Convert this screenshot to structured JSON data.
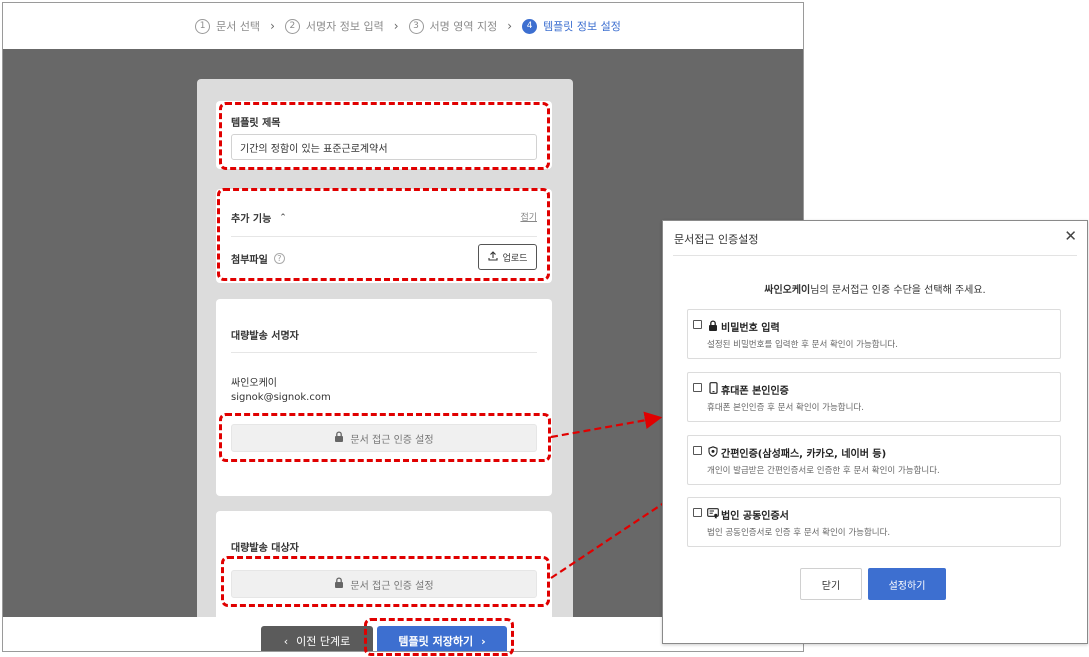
{
  "colors": {
    "accent": "#3d6fd0",
    "highlight": "#e00000",
    "dim_overlay": "#686868"
  },
  "stepper": {
    "steps": [
      {
        "num": "1",
        "label": "문서 선택"
      },
      {
        "num": "2",
        "label": "서명자 정보 입력"
      },
      {
        "num": "3",
        "label": "서명 영역 지정"
      },
      {
        "num": "4",
        "label": "템플릿 정보 설정"
      }
    ],
    "active_index": 3
  },
  "template_title": {
    "label": "템플릿 제목",
    "value": "기간의 정함이 있는 표준근로계약서"
  },
  "extra_features": {
    "label": "추가 기능",
    "collapse_link": "접기",
    "attachment_label": "첨부파일",
    "upload_label": "업로드"
  },
  "bulk_signer": {
    "heading": "대량발송 서명자",
    "name": "싸인오케이",
    "email": "signok@signok.com",
    "auth_button_label": "문서 접근 인증 설정"
  },
  "bulk_recipient": {
    "heading": "대량발송 대상자",
    "auth_button_label": "문서 접근 인증 설정"
  },
  "footer": {
    "prev_label": "이전 단계로",
    "save_label": "템플릿 저장하기"
  },
  "dialog": {
    "title": "문서접근 인증설정",
    "prompt_name": "싸인오케이",
    "prompt_rest": "님의 문서접근 인증 수단을 선택해 주세요.",
    "options": [
      {
        "icon": "lock-icon",
        "title": "비밀번호 입력",
        "desc": "설정된 비밀번호를 입력한 후 문서 확인이 가능합니다."
      },
      {
        "icon": "phone-icon",
        "title": "휴대폰 본인인증",
        "desc": "휴대폰 본인인증 후 문서 확인이 가능합니다."
      },
      {
        "icon": "shield-icon",
        "title": "간편인증(삼성패스, 카카오, 네이버 등)",
        "desc": "개인이 발급받은 간편인증서로 인증한 후 문서 확인이 가능합니다."
      },
      {
        "icon": "certificate-icon",
        "title": "법인 공동인증서",
        "desc": "법인 공동인증서로 인증 후 문서 확인이 가능합니다."
      }
    ],
    "close_label": "닫기",
    "apply_label": "설정하기"
  }
}
